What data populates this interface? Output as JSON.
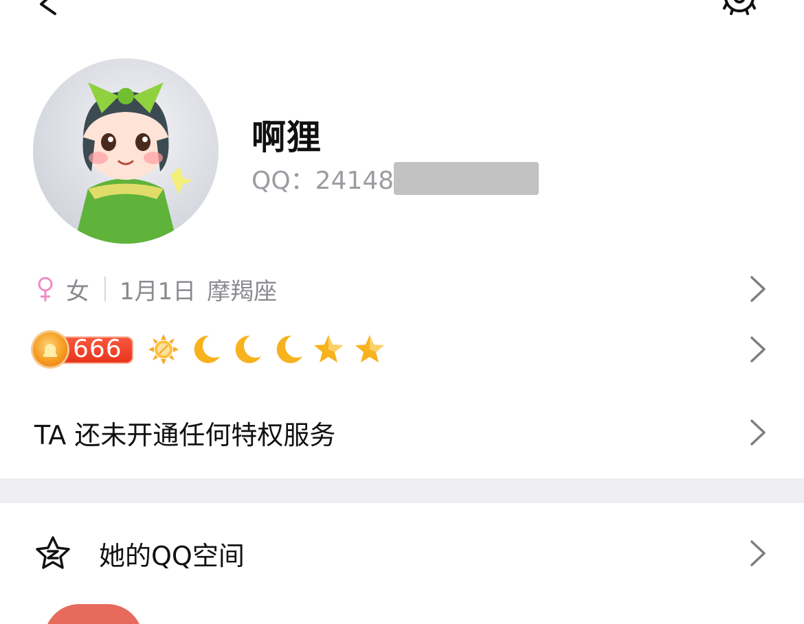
{
  "profile": {
    "nickname": "啊狸",
    "qq_label": "QQ：24148"
  },
  "info": {
    "gender": "女",
    "birthday": "1月1日",
    "zodiac": "摩羯座"
  },
  "level": {
    "value": "666",
    "icons": [
      "sun-icon",
      "moon-icon",
      "moon-icon",
      "moon-icon",
      "star-icon",
      "star-icon"
    ]
  },
  "privilege": {
    "text": "TA 还未开通任何特权服务"
  },
  "qzone": {
    "label": "她的QQ空间"
  },
  "colors": {
    "female_pink": "#f08bc4",
    "level_red": "#e8321c",
    "level_gold": "#f7a823",
    "separator": "#efeff2"
  }
}
